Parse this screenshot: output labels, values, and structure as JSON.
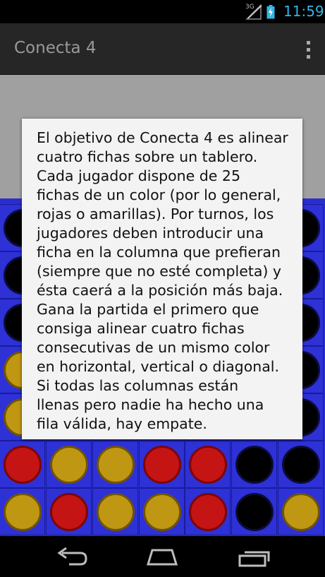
{
  "status_bar": {
    "network_label": "3G",
    "time": "11:59",
    "icons": [
      "signal-icon",
      "battery-charging-icon"
    ]
  },
  "action_bar": {
    "title": "Conecta 4",
    "overflow_icon": "overflow-menu-icon"
  },
  "dialog": {
    "text": "El objetivo de Conecta 4 es alinear\ncuatro fichas sobre un tablero.\nCada jugador dispone de 25\nfichas de un color (por lo general,\nrojas o amarillas). Por turnos, los\njugadores deben introducir una\nficha en la columna que prefieran\n(siempre que no esté completa) y\nésta caerá a la posición más baja.\nGana la partida el primero que\nconsiga alinear cuatro fichas\nconsecutivas de un mismo color\nen horizontal, vertical o diagonal.\nSi todas las columnas están\nllenas pero nadie ha hecho una\nfila válida, hay empate."
  },
  "board": {
    "columns": 7,
    "rows": 7,
    "cells": [
      [
        "empty",
        "empty",
        "empty",
        "empty",
        "empty",
        "empty",
        "empty"
      ],
      [
        "empty",
        "empty",
        "empty",
        "empty",
        "empty",
        "empty",
        "empty"
      ],
      [
        "empty",
        "empty",
        "empty",
        "empty",
        "empty",
        "empty",
        "empty"
      ],
      [
        "yellow",
        "empty",
        "empty",
        "empty",
        "empty",
        "empty",
        "empty"
      ],
      [
        "yellow",
        "empty",
        "empty",
        "empty",
        "empty",
        "empty",
        "empty"
      ],
      [
        "red",
        "yellow",
        "yellow",
        "red",
        "red",
        "empty",
        "empty"
      ],
      [
        "yellow",
        "red",
        "yellow",
        "yellow",
        "red",
        "empty",
        "yellow"
      ]
    ],
    "colors": {
      "board": "#2a2ed0",
      "red": "#c41414",
      "yellow": "#bf9712"
    }
  },
  "nav_bar": {
    "buttons": [
      "back-icon",
      "home-icon",
      "recent-apps-icon"
    ]
  },
  "colors": {
    "accent": "#33b5e5",
    "action_bar": "#262626",
    "dialog": "#f3f3f3"
  }
}
